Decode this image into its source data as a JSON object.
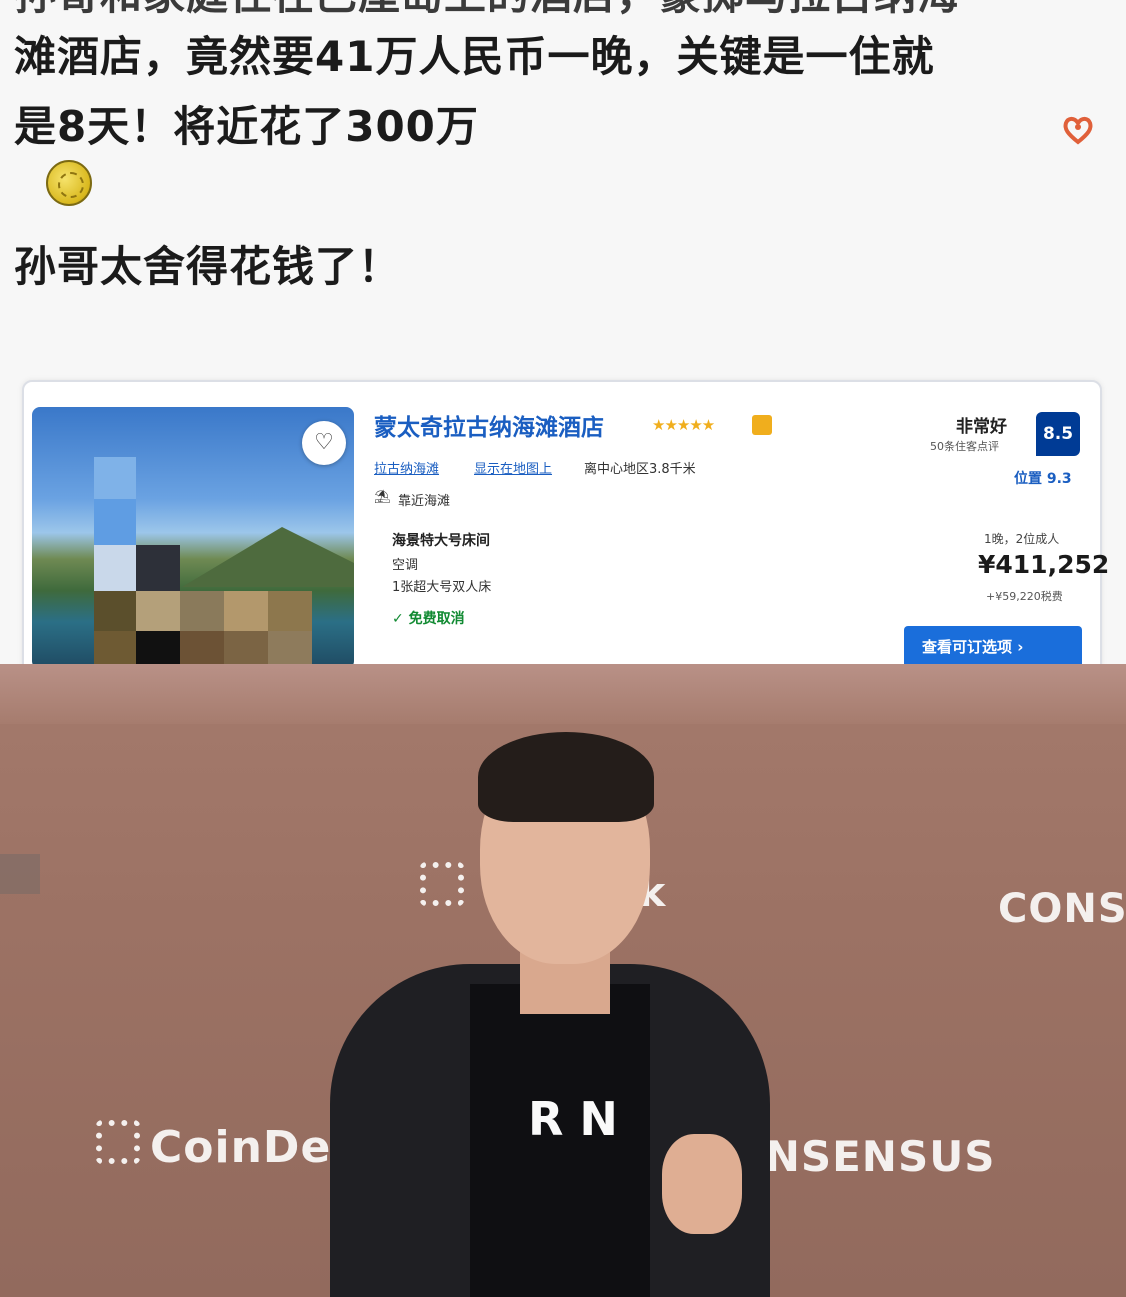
{
  "post": {
    "line0": "孙哥和家庭住在巴厘岛上的酒店，豪掷马拉古纳海",
    "line1": "滩酒店，竟然要41万人民币一晚，关键是一住就",
    "line2": "是8天！将近花了300万",
    "line3": "孙哥太舍得花钱了！"
  },
  "hotel": {
    "name": "蒙太奇拉古纳海滩酒店",
    "stars": "★★★★★",
    "links": [
      "拉古纳海滩",
      "显示在地图上"
    ],
    "distance": "离中心地区3.8千米",
    "near_beach": "靠近海滩",
    "room_title": "海景特大号床间",
    "amenity": "空调",
    "bed": "1张超大号双人床",
    "free_cancel": "✓ 免费取消",
    "rating_word": "非常好",
    "rating_sub": "50条住客点评",
    "score": "8.5",
    "location": "位置 9.3",
    "stay_info": "1晚，2位成人",
    "price": "¥411,252",
    "tax": "+¥59,220税费",
    "cta": "查看可订选项 ›"
  },
  "photo": {
    "logo_left": "CoinDes",
    "logo_center": "sk",
    "logo_right_top": "CONSE",
    "logo_right_bottom": "ONSENSUS",
    "shirt_logo": "R  N"
  },
  "colors": {
    "link_blue": "#1a5ec1",
    "score_bg": "#003b95",
    "cta_bg": "#1a6edb",
    "free_cancel": "#118a32",
    "stage_wall": "#9c7264"
  }
}
